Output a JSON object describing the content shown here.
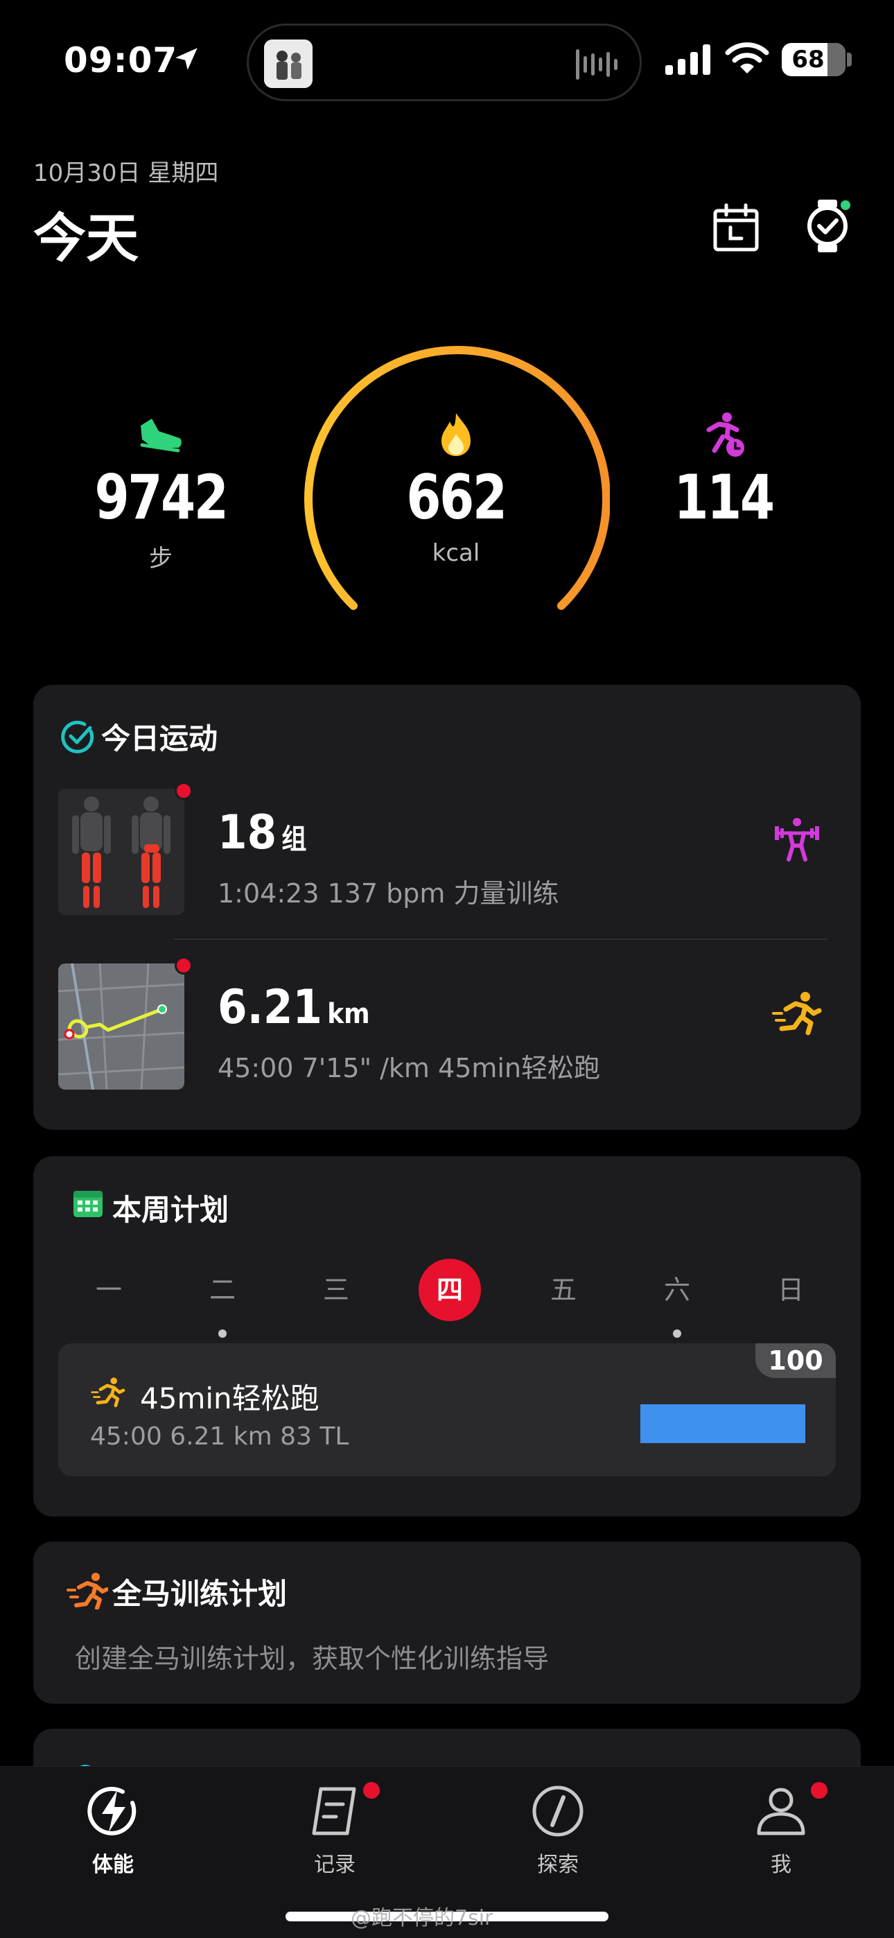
{
  "status_bar": {
    "time": "09:07",
    "battery": "68"
  },
  "header": {
    "date": "10月30日 星期四",
    "title": "今天"
  },
  "stats": {
    "steps": {
      "value": "9742",
      "unit": "步"
    },
    "calories": {
      "value": "662",
      "unit": "kcal"
    },
    "activity": {
      "value": "114",
      "unit": ""
    }
  },
  "today_workouts": {
    "title": "今日运动",
    "items": [
      {
        "main": "18",
        "unit": "组",
        "sub": "1:04:23  137 bpm  力量训练",
        "icon": "weightlifting-icon"
      },
      {
        "main": "6.21",
        "unit": "km",
        "sub": "45:00  7'15\" /km  45min轻松跑",
        "icon": "running-icon"
      }
    ]
  },
  "weekly_plan": {
    "title": "本周计划",
    "days": [
      "一",
      "二",
      "三",
      "四",
      "五",
      "六",
      "日"
    ],
    "active_day": "四",
    "item": {
      "title": "45min轻松跑",
      "sub": "45:00  6.21 km  83 TL",
      "score": "100",
      "bar_color": "#3f91f0"
    }
  },
  "marathon": {
    "title": "全马训练计划",
    "sub": "创建全马训练计划，获取个性化训练指导"
  },
  "tabbar": {
    "tabs": [
      {
        "label": "体能",
        "icon": "lightning-icon",
        "active": true
      },
      {
        "label": "记录",
        "icon": "record-icon",
        "badge": true
      },
      {
        "label": "探索",
        "icon": "compass-icon"
      },
      {
        "label": "我",
        "icon": "profile-icon",
        "badge": true
      }
    ]
  },
  "watermark": "@跑不停的7sir",
  "colors": {
    "accent_red": "#e8112d",
    "ring_start": "#ffc22e",
    "ring_end": "#f5922a",
    "steps_green": "#2fd37a",
    "activity_magenta": "#d23ad9"
  }
}
